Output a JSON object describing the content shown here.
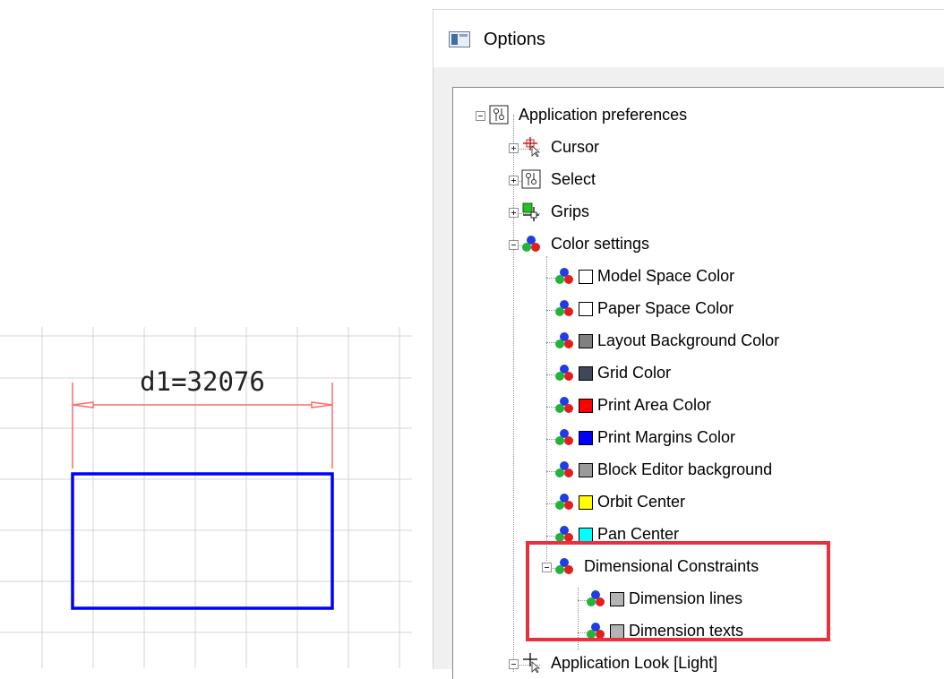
{
  "dialog": {
    "title": "Options"
  },
  "drawing": {
    "dimension_text": "d1=32076",
    "rectangle_color": "#0000ff",
    "dimension_color": "#ff6b6b"
  },
  "tree": {
    "root": {
      "label": "Application preferences",
      "icon": "settings-sliders-icon"
    },
    "items": [
      {
        "label": "Cursor",
        "icon": "cursor-crosshair-icon"
      },
      {
        "label": "Select",
        "icon": "settings-sliders-icon"
      },
      {
        "label": "Grips",
        "icon": "grips-icon"
      },
      {
        "label": "Color settings",
        "icon": "color-circles-icon"
      }
    ],
    "colors": [
      {
        "label": "Model Space Color",
        "swatch": "#ffffff"
      },
      {
        "label": "Paper Space Color",
        "swatch": "#ffffff"
      },
      {
        "label": "Layout Background Color",
        "swatch": "#808080"
      },
      {
        "label": "Grid Color",
        "swatch": "#404858"
      },
      {
        "label": "Print Area Color",
        "swatch": "#ff0000"
      },
      {
        "label": "Print Margins Color",
        "swatch": "#0000ff"
      },
      {
        "label": "Block Editor background",
        "swatch": "#9a9a9a"
      },
      {
        "label": "Orbit Center",
        "swatch": "#ffff00"
      },
      {
        "label": "Pan Center",
        "swatch": "#00ffff"
      }
    ],
    "dimensional": {
      "label": "Dimensional Constraints",
      "children": [
        {
          "label": "Dimension lines",
          "swatch": "#b4b4b4"
        },
        {
          "label": "Dimension texts",
          "swatch": "#b4b4b4"
        }
      ]
    },
    "look": {
      "label": "Application Look [Light]"
    }
  },
  "highlight_color": "#e6323e"
}
